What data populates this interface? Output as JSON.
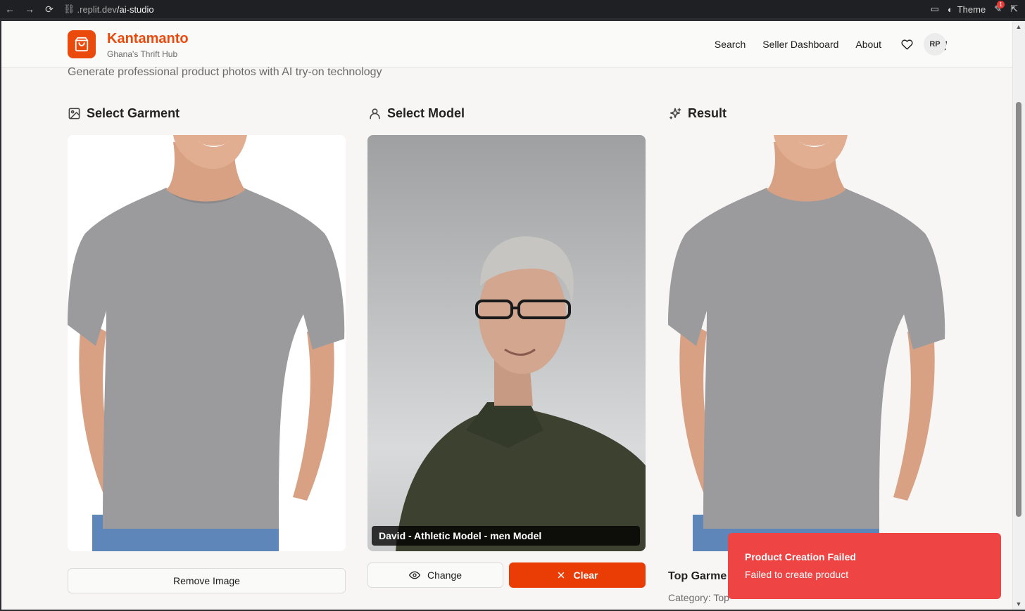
{
  "browser": {
    "url_domain": ".replit.dev",
    "url_path": "/ai-studio",
    "theme_label": "Theme",
    "notif_count": "1"
  },
  "header": {
    "brand_name": "Kantamanto",
    "brand_tagline": "Ghana's Thrift Hub",
    "nav": [
      "Search",
      "Seller Dashboard",
      "About"
    ],
    "avatar_initials": "RP"
  },
  "page": {
    "subtitle": "Generate professional product photos with AI try-on technology"
  },
  "columns": {
    "garment": {
      "title": "Select Garment",
      "remove_label": "Remove Image"
    },
    "model": {
      "title": "Select Model",
      "caption": "David - Athletic Model - men Model",
      "change_label": "Change",
      "clear_label": "Clear"
    },
    "result": {
      "title": "Result",
      "product_title": "Top Garme",
      "category": "Category: Top"
    }
  },
  "toast": {
    "title": "Product Creation Failed",
    "message": "Failed to create product"
  },
  "colors": {
    "brand": "#ea4a0c",
    "clear": "#ea3d06",
    "toast": "#ef4444"
  }
}
